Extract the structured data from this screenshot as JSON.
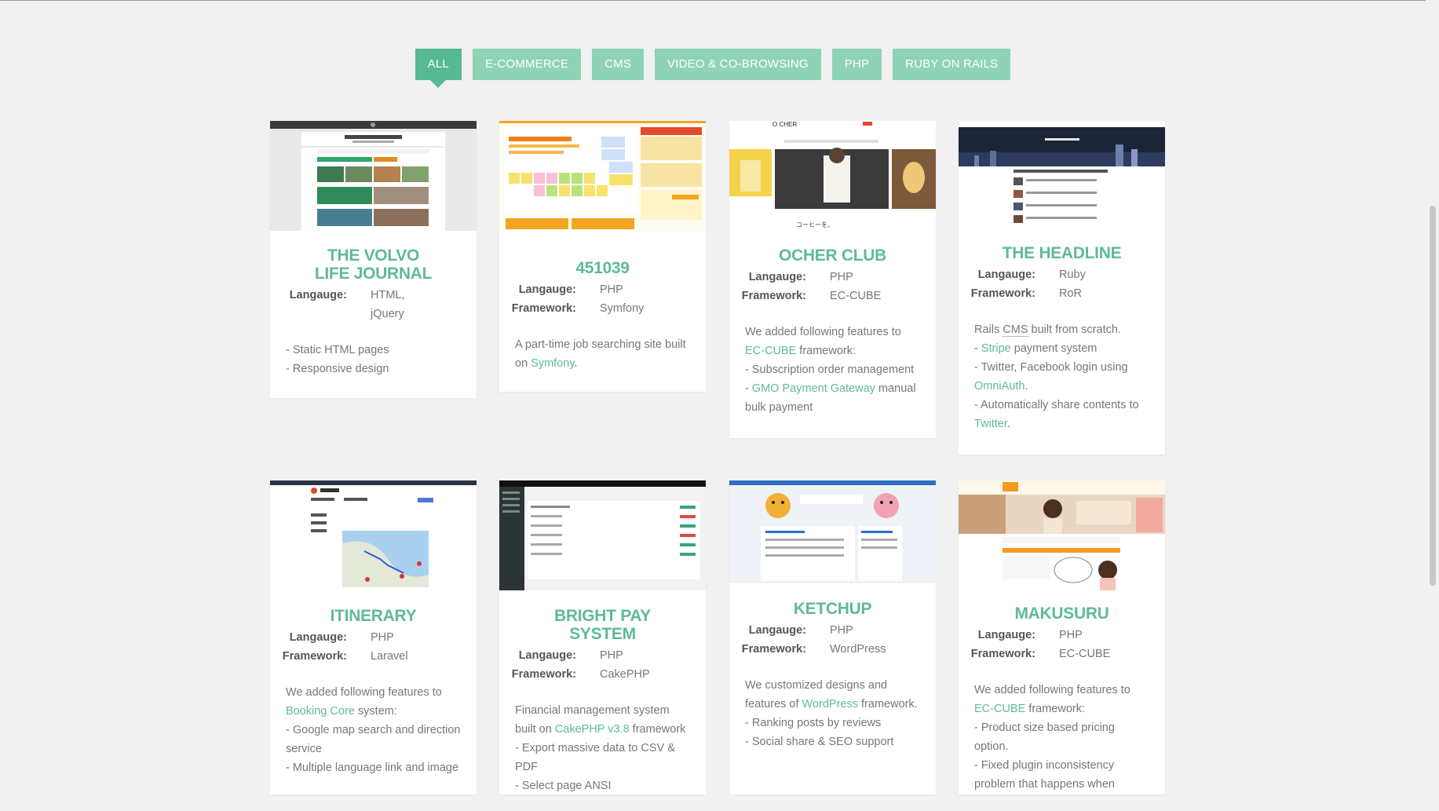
{
  "filters": [
    {
      "label": "ALL",
      "active": true
    },
    {
      "label": "E-COMMERCE",
      "active": false
    },
    {
      "label": "CMS",
      "active": false
    },
    {
      "label": "VIDEO & CO-BROWSING",
      "active": false
    },
    {
      "label": "PHP",
      "active": false
    },
    {
      "label": "RUBY ON RAILS",
      "active": false
    }
  ],
  "labels": {
    "language": "Langauge:",
    "framework": "Framework:"
  },
  "cards": [
    {
      "title": "THE VOLVO LIFE JOURNAL",
      "language": "HTML, jQuery",
      "desc": [
        [
          {
            "t": "- Static HTML pages"
          }
        ],
        [
          {
            "t": "- Responsive design"
          }
        ]
      ]
    },
    {
      "title": "451039",
      "language": "PHP",
      "framework": "Symfony",
      "desc": [
        [
          {
            "t": "A part-time job searching site built on "
          },
          {
            "t": "Symfony",
            "link": true
          },
          {
            "t": "."
          }
        ]
      ]
    },
    {
      "title": "OCHER CLUB",
      "language": "PHP",
      "framework": "EC-CUBE",
      "thumb_text": {
        "logo": "O CHER",
        "caption": "コーヒーを、"
      },
      "desc": [
        [
          {
            "t": "We added following features to "
          },
          {
            "t": "EC-CUBE",
            "link": true
          },
          {
            "t": " framework:"
          }
        ],
        [
          {
            "t": "- Subscription order management"
          }
        ],
        [
          {
            "t": "- "
          },
          {
            "t": "GMO Payment Gateway",
            "link": true
          },
          {
            "t": " manual bulk payment"
          }
        ]
      ]
    },
    {
      "title": "THE HEADLINE",
      "language": "Ruby",
      "framework": "RoR",
      "desc": [
        [
          {
            "t": "Rails "
          },
          {
            "t": "CMS",
            "underline": true
          },
          {
            "t": " built from scratch."
          }
        ],
        [
          {
            "t": "- "
          },
          {
            "t": "Stripe",
            "link": true
          },
          {
            "t": " payment system"
          }
        ],
        [
          {
            "t": "- Twitter, Facebook login using "
          },
          {
            "t": "OmniAuth",
            "link": true
          },
          {
            "t": "."
          }
        ],
        [
          {
            "t": "- Automatically share contents to "
          },
          {
            "t": "Twitter",
            "link": true
          },
          {
            "t": "."
          }
        ]
      ]
    },
    {
      "title": "ITINERARY",
      "language": "PHP",
      "framework": "Laravel",
      "desc": [
        [
          {
            "t": "We added following features to "
          },
          {
            "t": "Booking Core",
            "link": true
          },
          {
            "t": " system:"
          }
        ],
        [
          {
            "t": "- Google map search and direction service"
          }
        ],
        [
          {
            "t": "- Multiple language link and image"
          }
        ]
      ]
    },
    {
      "title": "BRIGHT PAY SYSTEM",
      "language": "PHP",
      "framework": "CakePHP",
      "desc": [
        [
          {
            "t": "Financial management system built on "
          },
          {
            "t": "CakePHP v3.8",
            "link": true
          },
          {
            "t": " framework"
          }
        ],
        [
          {
            "t": "- Export massive data to CSV & PDF"
          }
        ],
        [
          {
            "t": "- Select page ANSI"
          }
        ]
      ]
    },
    {
      "title": "KETCHUP",
      "language": "PHP",
      "framework": "WordPress",
      "desc": [
        [
          {
            "t": "We customized designs and features of "
          },
          {
            "t": "WordPress",
            "link": true
          },
          {
            "t": " framework."
          }
        ],
        [
          {
            "t": "- Ranking posts by reviews"
          }
        ],
        [
          {
            "t": "- Social share & SEO support"
          }
        ]
      ]
    },
    {
      "title": "MAKUSURU",
      "language": "PHP",
      "framework": "EC-CUBE",
      "desc": [
        [
          {
            "t": "We added following features to "
          },
          {
            "t": "EC-CUBE",
            "link": true
          },
          {
            "t": " framework:"
          }
        ],
        [
          {
            "t": "- Product size based pricing option."
          }
        ],
        [
          {
            "t": "- Fixed plugin inconsistency problem that happens when"
          }
        ]
      ]
    }
  ]
}
